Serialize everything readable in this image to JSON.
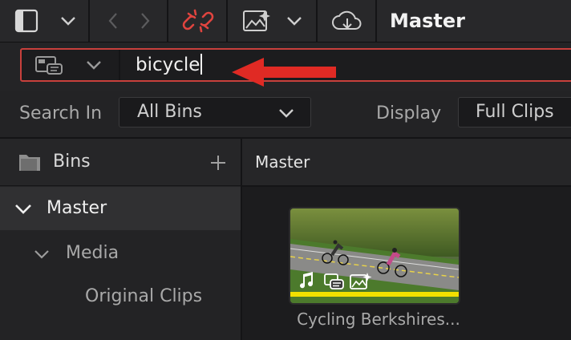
{
  "toolbar": {
    "title": "Master",
    "icons": [
      "sidebar-icon",
      "chevron-down-icon",
      "back-arrow-icon",
      "forward-arrow-icon",
      "unlink-icon",
      "image-effects-icon",
      "chevron-down-icon",
      "cloud-download-icon"
    ]
  },
  "search": {
    "value": "bicycle",
    "filter_icon": "metadata-filter-icon"
  },
  "options": {
    "search_in_label": "Search In",
    "search_in_value": "All Bins",
    "display_label": "Display",
    "display_value": "Full Clips"
  },
  "bins": {
    "header": "Bins",
    "items": [
      {
        "label": "Master",
        "expanded": true
      },
      {
        "label": "Media",
        "expanded": true
      },
      {
        "label": "Original Clips"
      }
    ]
  },
  "media_pool": {
    "header": "Master",
    "clips": [
      {
        "name": "Cycling Berkshires...",
        "badges": [
          "music-note-icon",
          "metadata-icon",
          "effects-icon"
        ]
      }
    ]
  },
  "colors": {
    "accent_red": "#c8403c",
    "highlight_yellow": "#f2e000"
  }
}
